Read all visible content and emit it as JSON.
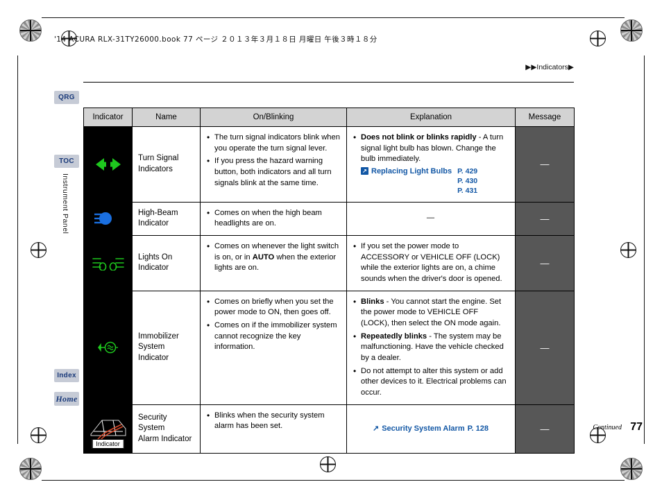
{
  "header": {
    "bookline": "'14 ACURA RLX-31TY26000.book   77 ページ   ２０１３年３月１８日   月曜日   午後３時１８分",
    "nav": "▶▶Indicators▶"
  },
  "tabs": {
    "qrg": "QRG",
    "toc": "TOC",
    "index": "Index",
    "home": "Home",
    "side_label": "Instrument Panel"
  },
  "table": {
    "columns": [
      "Indicator",
      "Name",
      "On/Blinking",
      "Explanation",
      "Message"
    ],
    "rows": [
      {
        "icon": "turn-signal-arrows-icon",
        "name": "Turn Signal\nIndicators",
        "onblinking": [
          "The turn signal indicators blink when you operate the turn signal lever.",
          "If you press the hazard warning button, both indicators and all turn signals blink at the same time."
        ],
        "explanation_lead_bold": "Does not blink or blinks rapidly",
        "explanation_lead_rest": " - A turn signal light bulb has blown. Change the bulb immediately.",
        "ref_label": "Replacing Light Bulbs",
        "ref_pages": [
          "P. 429",
          "P. 430",
          "P. 431"
        ],
        "message": "—"
      },
      {
        "icon": "high-beam-icon",
        "name": "High-Beam\nIndicator",
        "onblinking": [
          "Comes on when the high beam headlights are on."
        ],
        "explanation_dash": "—",
        "message": "—"
      },
      {
        "icon": "lights-on-icon",
        "name": "Lights On\nIndicator",
        "onblinking_html": "Comes on whenever the light switch is on, or in <b>AUTO</b> when the exterior lights are on.",
        "explanation": [
          "If you set the power mode to ACCESSORY or VEHICLE OFF (LOCK) while the exterior lights are on, a chime sounds when the driver's door is opened."
        ],
        "message": "—"
      },
      {
        "icon": "immobilizer-key-icon",
        "name": "Immobilizer\nSystem Indicator",
        "onblinking": [
          "Comes on briefly when you set the power mode to ON, then goes off.",
          "Comes on if the immobilizer system cannot recognize the key information."
        ],
        "explanation_items": [
          {
            "bold": "Blinks",
            "rest": " - You cannot start the engine. Set the power mode to VEHICLE OFF (LOCK), then select the ON mode again."
          },
          {
            "bold": "Repeatedly blinks",
            "rest": " - The system may be malfunctioning. Have the vehicle checked by a dealer."
          },
          {
            "bold": "",
            "rest": "Do not attempt to alter this system or add other devices to it. Electrical problems can occur."
          }
        ],
        "message": "—"
      },
      {
        "icon": "security-system-alarm-icon",
        "icon_caption": "Indicator",
        "name": "Security System\nAlarm Indicator",
        "onblinking": [
          "Blinks when the security system alarm has been set."
        ],
        "ref_label": "Security System Alarm",
        "ref_page": "P. 128",
        "message": "—"
      }
    ]
  },
  "footer": {
    "continued": "Continued",
    "page": "77"
  }
}
